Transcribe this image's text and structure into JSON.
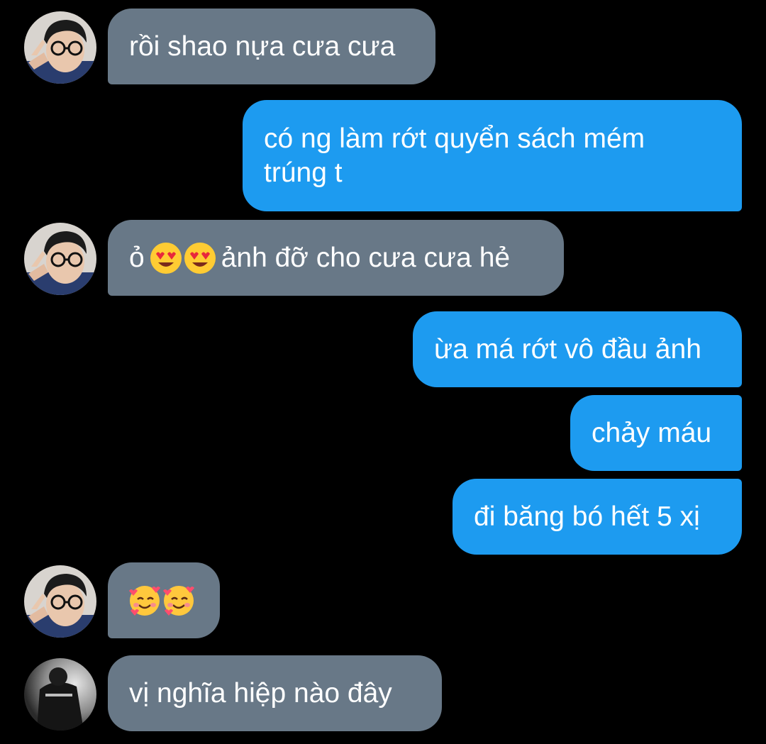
{
  "messages": [
    {
      "id": "m1",
      "side": "received",
      "text": "rồi shao nựa cưa cưa"
    },
    {
      "id": "m2",
      "side": "sent",
      "text": "có ng làm rớt quyển sách mém trúng t"
    },
    {
      "id": "m3",
      "side": "received",
      "prefix": "ỏ",
      "emojis": [
        "heart-eyes-emoji",
        "heart-eyes-emoji"
      ],
      "suffix": "ảnh đỡ cho cưa cưa hẻ"
    },
    {
      "id": "m4",
      "side": "sent",
      "text": "ừa má rớt vô đầu ảnh"
    },
    {
      "id": "m5",
      "side": "sent",
      "text": "chảy máu"
    },
    {
      "id": "m6",
      "side": "sent",
      "text": "đi băng bó hết 5 xị"
    },
    {
      "id": "m7",
      "side": "received",
      "emojis": [
        "smiling-face-with-hearts-emoji",
        "smiling-face-with-hearts-emoji"
      ]
    },
    {
      "id": "m8",
      "side": "received",
      "text": "vị nghĩa hiệp nào đây"
    }
  ],
  "colors": {
    "background": "#000000",
    "received_bubble": "#687887",
    "sent_bubble": "#1d9bf0",
    "text": "#ffffff"
  }
}
